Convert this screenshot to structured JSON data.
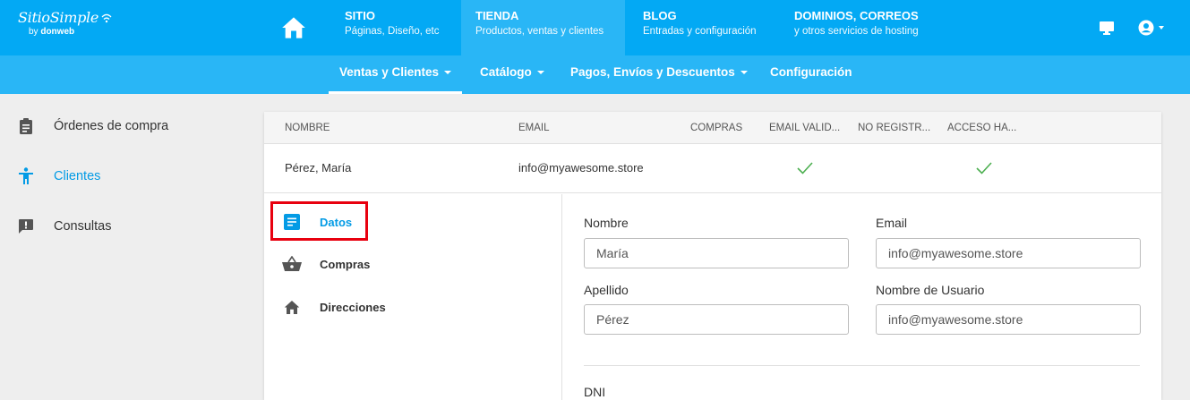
{
  "brand": {
    "name": "SitioSimple",
    "by": "by",
    "company": "donweb"
  },
  "topnav": [
    {
      "title": "SITIO",
      "subtitle": "Páginas, Diseño, etc"
    },
    {
      "title": "TIENDA",
      "subtitle": "Productos, ventas y clientes"
    },
    {
      "title": "BLOG",
      "subtitle": "Entradas y configuración"
    },
    {
      "title": "DOMINIOS, CORREOS",
      "subtitle": "y otros servicios de hosting"
    }
  ],
  "subnav": [
    {
      "label": "Ventas y Clientes"
    },
    {
      "label": "Catálogo"
    },
    {
      "label": "Pagos, Envíos y Descuentos"
    },
    {
      "label": "Configuración"
    }
  ],
  "sidebar": [
    {
      "label": "Órdenes de compra",
      "icon": "clipboard-icon"
    },
    {
      "label": "Clientes",
      "icon": "person-icon"
    },
    {
      "label": "Consultas",
      "icon": "feedback-icon"
    }
  ],
  "table": {
    "columns": [
      "NOMBRE",
      "EMAIL",
      "COMPRAS",
      "EMAIL VALID...",
      "NO REGISTR...",
      "ACCESO HA..."
    ],
    "row": {
      "nombre": "Pérez, María",
      "email": "info@myawesome.store"
    }
  },
  "detail_tabs": [
    {
      "label": "Datos",
      "icon": "notes-icon"
    },
    {
      "label": "Compras",
      "icon": "basket-icon"
    },
    {
      "label": "Direcciones",
      "icon": "home-icon"
    }
  ],
  "form": {
    "nombre_label": "Nombre",
    "nombre_value": "María",
    "email_label": "Email",
    "email_value": "info@myawesome.store",
    "apellido_label": "Apellido",
    "apellido_value": "Pérez",
    "usuario_label": "Nombre de Usuario",
    "usuario_value": "info@myawesome.store",
    "dni_label": "DNI"
  },
  "colors": {
    "primary": "#03a9f4",
    "secondary": "#29b6f6",
    "accent": "#039be5",
    "check": "#4caf50",
    "highlight": "#e8000f"
  }
}
